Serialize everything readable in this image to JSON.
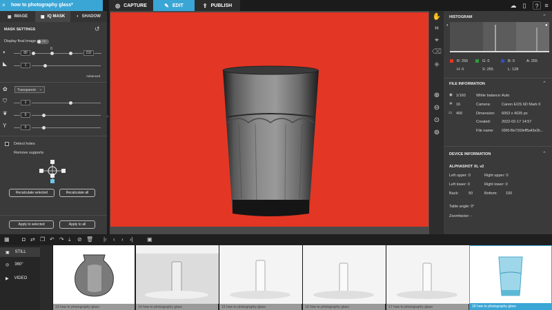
{
  "document": {
    "title": "how to photography glass*",
    "close": "×"
  },
  "modes": [
    {
      "label": "CAPTURE"
    },
    {
      "label": "EDIT"
    },
    {
      "label": "PUBLISH"
    }
  ],
  "left_tabs": [
    {
      "label": "IMAGE"
    },
    {
      "label": "IQ MASK"
    },
    {
      "label": "SHADOW"
    }
  ],
  "mask": {
    "header": "MASK SETTINGS",
    "display_final_image": "Display final image",
    "toggle_state": "Off",
    "tolerance_low": "80",
    "tolerance_mid": "0",
    "tolerance_high": "232",
    "feather": "1",
    "advanced": "Advanced",
    "background": "Transparent",
    "val1": "1",
    "val2": "0",
    "val3": "0",
    "detect_holes": "Detect holes",
    "remove_supports": "Remove supports",
    "recalc_selected": "Recalculate selected",
    "recalc_all": "Recalculate all",
    "apply_selected": "Apply to selected",
    "apply_all": "Apply to all"
  },
  "histogram": {
    "title": "HISTOGRAM",
    "r": "R:  255",
    "g": "G:  0",
    "b": "B:  0",
    "a": "A:  255",
    "h": "H:  0",
    "s": "S:  255",
    "l": "L:  128"
  },
  "file_info": {
    "title": "FILE INFORMATION",
    "shutter": "1/160",
    "aperture": "16",
    "iso": "400",
    "wb_label": "White balance:",
    "wb": "Auto",
    "camera_label": "Camera:",
    "camera": "Canon EOS 6D Mark II",
    "dim_label": "Dimension:",
    "dim": "6053 x 4035 px",
    "created_label": "Created:",
    "created": "2022-02-17 14:57",
    "file_label": "File name:",
    "file": "0306-f9e7169eff5a43e2b..."
  },
  "device": {
    "title": "DEVICE INFORMATION",
    "model": "ALPHASHOT XL v2",
    "left_upper": "Left upper:  0",
    "right_upper": "Right upper:  0",
    "left_lower": "Left lower:  0",
    "right_lower": "Right lower:  0",
    "back": "Back:",
    "back_val": "50",
    "bottom": "Bottom:",
    "bottom_val": "100",
    "table_angle": "Table angle:  0°",
    "zoomfactor": "Zoomfactor:  -"
  },
  "film_nav": [
    {
      "label": "STILL"
    },
    {
      "label": "360°"
    },
    {
      "label": "VIDEO"
    }
  ],
  "thumbs": [
    {
      "caption": "13 how to photography glass"
    },
    {
      "caption": "14 how to photography glass"
    },
    {
      "caption": "15 how to photography glass"
    },
    {
      "caption": "16 how to photography glass"
    },
    {
      "caption": "17 how to photography glass"
    },
    {
      "caption": "18 how to photography glass"
    }
  ],
  "colors": {
    "accent": "#3aa6d6",
    "background_red": "#e43624"
  }
}
